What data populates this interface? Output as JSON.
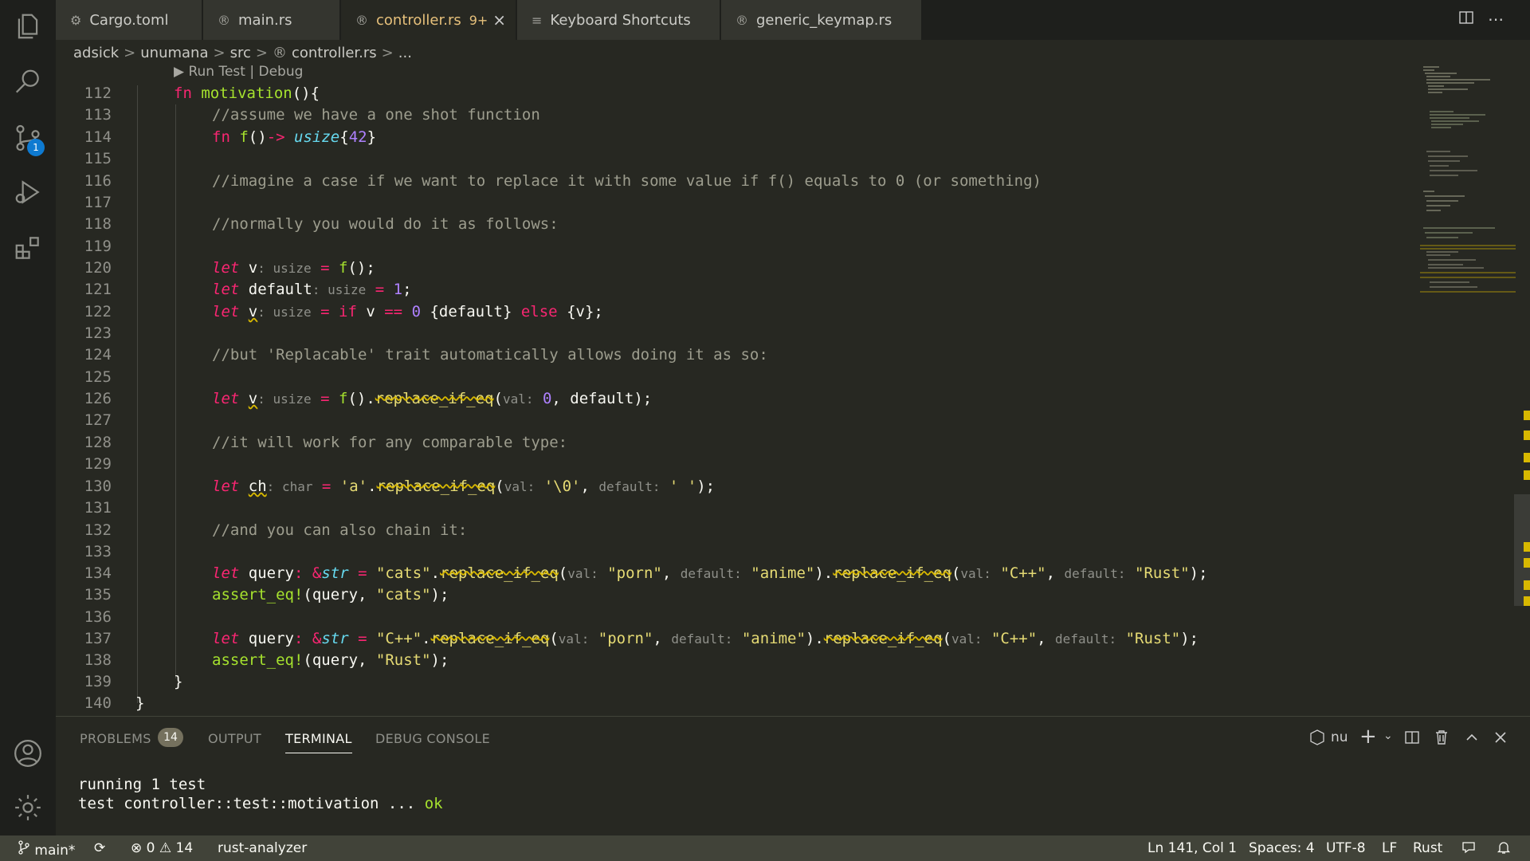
{
  "tabs": [
    {
      "label": "Cargo.toml",
      "icon": "gear-icon",
      "glyph": "⚙"
    },
    {
      "label": "main.rs",
      "icon": "rust-icon",
      "glyph": "®"
    },
    {
      "label": "controller.rs",
      "icon": "rust-icon",
      "glyph": "®",
      "modified": "9+",
      "close": "×"
    },
    {
      "label": "Keyboard Shortcuts",
      "icon": "keyboard-shortcuts-icon",
      "glyph": "≡"
    },
    {
      "label": "generic_keymap.rs",
      "icon": "rust-icon",
      "glyph": "®"
    }
  ],
  "breadcrumb": [
    "adsick",
    "unumana",
    "src",
    "controller.rs",
    "..."
  ],
  "breadcrumb_sep": ">",
  "codelens": "▶ Run Test | Debug",
  "scm_badge": "1",
  "lines": [
    "112",
    "113",
    "114",
    "115",
    "116",
    "117",
    "118",
    "119",
    "120",
    "121",
    "122",
    "123",
    "124",
    "125",
    "126",
    "127",
    "128",
    "129",
    "130",
    "131",
    "132",
    "133",
    "134",
    "135",
    "136",
    "137",
    "138",
    "139",
    "140"
  ],
  "code": {
    "l112": {
      "a": "fn",
      "b": "motivation",
      "c": "(){"
    },
    "l113": "//assume we have a one shot function",
    "l114": {
      "a": "fn",
      "b": "f",
      "c": "()",
      "d": "->",
      "e": "usize",
      "f": "{",
      "g": "42",
      "h": "}"
    },
    "l116": "//imagine a case if we want to replace it with some value if f() equals to 0 (or something)",
    "l118": "//normally you would do it as follows:",
    "l120": {
      "a": "let",
      "b": " v",
      "c": ": usize",
      "d": " = ",
      "e": "f",
      "f": "();"
    },
    "l121": {
      "a": "let",
      "b": " default",
      "c": ": usize",
      "d": " = ",
      "e": "1",
      "f": ";"
    },
    "l122": {
      "a": "let",
      "b": "v",
      "c": ": usize",
      "d": " = ",
      "e": "if",
      "f": " v ",
      "g": "==",
      "h": "0",
      "i": " {default} ",
      "j": "else",
      "k": " {v};"
    },
    "l124": "//but 'Replacable' trait automatically allows doing it as so:",
    "l126": {
      "a": "let",
      "b": "v",
      "c": ": usize",
      "d": " = ",
      "e": "f",
      "f": "().",
      "g": "replace_if_eq",
      "h": "(",
      "i": "val:",
      "j": "0",
      "k": ", default);"
    },
    "l128": "//it will work for any comparable type:",
    "l130": {
      "a": "let",
      "b": "ch",
      "c": ": char",
      "d": " = ",
      "e": "'a'",
      "f": ".",
      "g": "replace_if_eq",
      "h": "(",
      "i": "val:",
      "j": "'\\0'",
      "k": ", ",
      "l": "default:",
      "m": "' '",
      "n": ");"
    },
    "l132": "//and you can also chain it:",
    "l134": {
      "a": "let",
      "b": " query",
      "c": ": ",
      "d": "&",
      "e": "str",
      "f": " = ",
      "g": "\"cats\"",
      "h": ".",
      "i": "replace_if_eq",
      "j": "(",
      "k": "val:",
      "l": "\"porn\"",
      "m": ", ",
      "n": "default:",
      "o": "\"anime\"",
      "p": ").",
      "q": "replace_if_eq",
      "r": "(",
      "s": "val:",
      "t": "\"C++\"",
      "u": ", ",
      "v": "default:",
      "w": "\"Rust\"",
      "x": ");"
    },
    "l135": {
      "a": "assert_eq!",
      "b": "(query, ",
      "c": "\"cats\"",
      "d": ");"
    },
    "l137": {
      "a": "let",
      "b": " query",
      "c": ": ",
      "d": "&",
      "e": "str",
      "f": " = ",
      "g": "\"C++\"",
      "h": ".",
      "i": "replace_if_eq",
      "j": "(",
      "k": "val:",
      "l": "\"porn\"",
      "m": ", ",
      "n": "default:",
      "o": "\"anime\"",
      "p": ").",
      "q": "replace_if_eq",
      "r": "(",
      "s": "val:",
      "t": "\"C++\"",
      "u": ", ",
      "v": "default:",
      "w": "\"Rust\"",
      "x": ");"
    },
    "l138": {
      "a": "assert_eq!",
      "b": "(query, ",
      "c": "\"Rust\"",
      "d": ");"
    },
    "l139": "}",
    "l140": "}"
  },
  "panel": {
    "tabs": [
      "PROBLEMS",
      "OUTPUT",
      "TERMINAL",
      "DEBUG CONSOLE"
    ],
    "problems_count": "14",
    "shell": "nu",
    "terminal": {
      "line1": "running 1 test",
      "line2_prefix": "test controller::test::motivation ... ",
      "line2_ok": "ok"
    }
  },
  "status": {
    "branch": "main*",
    "errors": "0",
    "warnings": "14",
    "extension": "rust-analyzer",
    "position": "Ln 141, Col 1",
    "spaces": "Spaces: 4",
    "encoding": "UTF-8",
    "eol": "LF",
    "language": "Rust"
  },
  "colors": {
    "accent": "#e6c07b",
    "badge": "#0e7ad1",
    "warning": "#d8b800",
    "string": "#e6db74",
    "keyword": "#f92672",
    "function": "#a6e22e"
  }
}
